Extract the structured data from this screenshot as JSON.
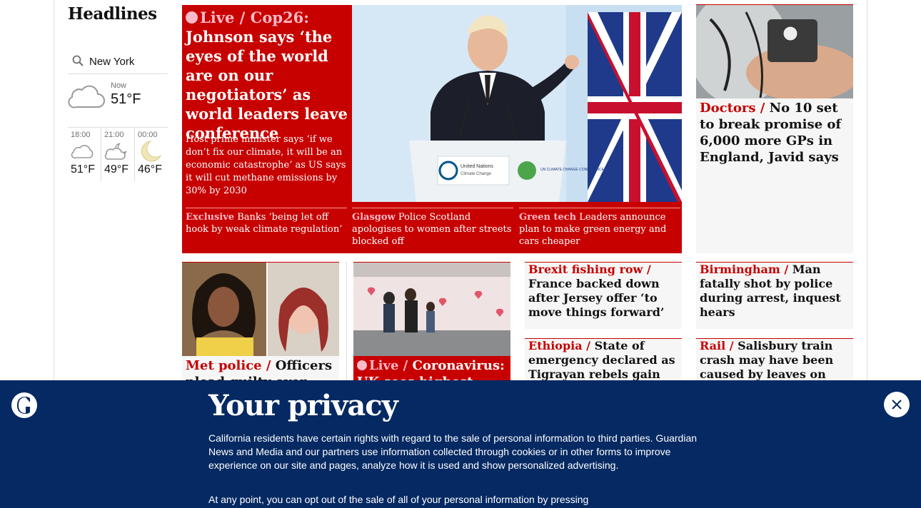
{
  "sidebar": {
    "title": "Headlines",
    "weather": {
      "location": "New York",
      "now_label": "Now",
      "now_temp": "51°F",
      "forecast": [
        {
          "time": "18:00",
          "temp": "51°F",
          "icon": "cloud-icon"
        },
        {
          "time": "21:00",
          "temp": "49°F",
          "icon": "cloud-moon-icon"
        },
        {
          "time": "00:00",
          "temp": "46°F",
          "icon": "moon-icon"
        }
      ]
    }
  },
  "lead": {
    "live_label": "Live",
    "kicker": "Cop26:",
    "headline": "Johnson says ‘the eyes of the world are on our negotiators’ as world leaders leave conference",
    "standfirst": "Host prime minister says ‘if we don’t fix our climate, it will be an economic catastrophe’ as US says it will cut methane emissions by 30% by 2030",
    "sublinks": [
      {
        "kicker": "Exclusive",
        "text": "Banks ‘being let off hook by weak climate regulation’"
      },
      {
        "kicker": "Glasgow",
        "text": "Police Scotland apologises to women after streets blocked off"
      },
      {
        "kicker": "Green tech",
        "text": "Leaders announce plan to make green energy and cars cheaper"
      }
    ],
    "podium_sign_left": "United Nations",
    "podium_sign_left_sub": "Climate Change",
    "podium_sign_right": "UN CLIMATE CHANGE CONFERENCE UK 2021"
  },
  "right_top": {
    "kicker": "Doctors",
    "headline": "No 10 set to break promise of 6,000 more GPs in England, Javid says"
  },
  "row2": {
    "met": {
      "kicker": "Met police",
      "headline": "Officers plead guilty over"
    },
    "covid": {
      "live_label": "Live",
      "kicker": "Coronavirus:",
      "headline": "UK sees highest daily"
    },
    "brexit": {
      "kicker": "Brexit fishing row",
      "headline": "France backed down after Jersey offer ‘to move things forward’"
    },
    "ethiopia": {
      "kicker": "Ethiopia",
      "headline": "State of emergency declared as Tigrayan rebels gain"
    },
    "birmingham": {
      "kicker": "Birmingham",
      "headline": "Man fatally shot by police during arrest, inquest hears"
    },
    "rail": {
      "kicker": "Rail",
      "headline": "Salisbury train crash may have been caused by leaves on line"
    }
  },
  "banner": {
    "title": "Your privacy",
    "p1": "California residents have certain rights with regard to the sale of personal information to third parties. Guardian News and Media and our partners use information collected through cookies or in other forms to improve experience on our site and pages, analyze how it is used and show personalized advertising.",
    "p2": "At any point, you can opt out of the sale of all of your personal information by pressing"
  },
  "colors": {
    "red": "#c70000",
    "navy": "#052962",
    "pink": "#ffbac8"
  }
}
